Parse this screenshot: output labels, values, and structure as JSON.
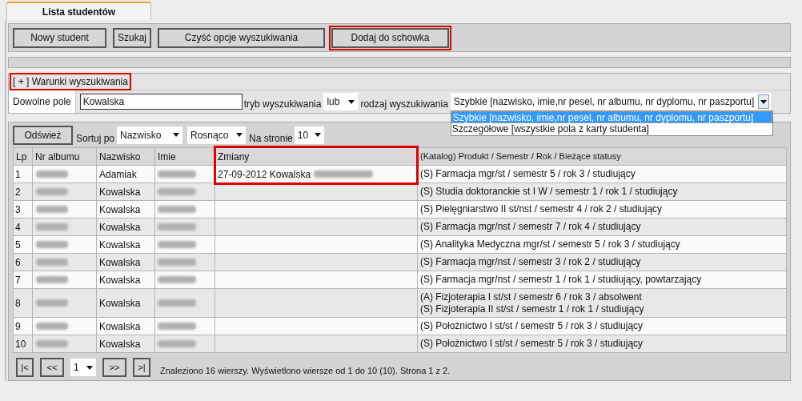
{
  "tabs": [
    {
      "label": "Lista studentów",
      "selected": true
    }
  ],
  "toolbar": {
    "buttons": [
      {
        "label": "Nowy student",
        "highlighted": false
      },
      {
        "label": "Szukaj",
        "highlighted": false
      },
      {
        "label": "Czyść opcje wyszukiwania",
        "highlighted": false
      },
      {
        "label": "Dodaj do schowka",
        "highlighted": true
      }
    ]
  },
  "search": {
    "toggle": {
      "label": "[ + ] Warunki wyszukiwania",
      "highlighted": true
    },
    "field_label": "Dowolne pole",
    "field_value": "Kowalska",
    "mode_label": "tryb wyszukiwania",
    "mode_value": "lub",
    "type_label": "rodzaj wyszukiwania",
    "type_value": "Szybkie [nazwisko, imie,nr pesel, nr albumu, nr dyplomu, nr paszportu]",
    "type_options": [
      {
        "label": "Szybkie [nazwisko, imie,nr pesel, nr albumu, nr dyplomu, nr paszportu]",
        "selected": true
      },
      {
        "label": "Szczegółowe [wszystkie pola z karty studenta]",
        "selected": false
      }
    ]
  },
  "results": {
    "refresh": "Odśwież",
    "sort_label": "Sortuj po",
    "sort_field": "Nazwisko",
    "sort_order": "Rosnąco",
    "per_page_label": "Na stronie",
    "per_page": "10",
    "columns": [
      {
        "label": "Lp",
        "highlighted": false
      },
      {
        "label": "Nr albumu",
        "highlighted": false
      },
      {
        "label": "Nazwisko",
        "highlighted": false
      },
      {
        "label": "Imie",
        "highlighted": false
      },
      {
        "label": "Zmiany",
        "highlighted": true
      },
      {
        "label": "(Katalog) Produkt / Semestr / Rok / Bieżące statusy",
        "highlighted": false
      }
    ],
    "rows": [
      {
        "lp": "1",
        "blurred": true,
        "surname": "Adamiak",
        "changes": "27-09-2012 Kowalska",
        "changes_blurred": true,
        "programs": [
          "(S) Farmacja mgr/st / semestr 5 / rok 3 / studiujący"
        ]
      },
      {
        "lp": "2",
        "blurred": true,
        "surname": "Kowalska",
        "programs": [
          "(S) Studia doktoranckie st I W / semestr 1 / rok 1 / studiujący"
        ]
      },
      {
        "lp": "3",
        "blurred": true,
        "surname": "Kowalska",
        "programs": [
          "(S) Pielęgniarstwo II st/nst / semestr 4 / rok 2 / studiujący"
        ]
      },
      {
        "lp": "4",
        "blurred": true,
        "surname": "Kowalska",
        "programs": [
          "(S) Farmacja mgr/nst / semestr 7 / rok 4 / studiujący"
        ]
      },
      {
        "lp": "5",
        "blurred": true,
        "surname": "Kowalska",
        "programs": [
          "(S) Analityka Medyczna mgr/st / semestr 5 / rok 3 / studiujący"
        ]
      },
      {
        "lp": "6",
        "blurred": true,
        "surname": "Kowalska",
        "programs": [
          "(S) Farmacja mgr/nst / semestr 3 / rok 2 / studiujący"
        ]
      },
      {
        "lp": "7",
        "blurred": true,
        "surname": "Kowalska",
        "programs": [
          "(S) Farmacja mgr/nst / semestr 1 / rok 1 / studiujący, powtarzający"
        ]
      },
      {
        "lp": "8",
        "blurred": true,
        "surname": "Kowalska",
        "programs": [
          "(A) Fizjoterapia I st/st / semestr 6 / rok 3 / absolwent",
          "(S) Fizjoterapia II st/st / semestr 1 / rok 1 / studiujący"
        ]
      },
      {
        "lp": "9",
        "blurred": true,
        "surname": "Kowalska",
        "programs": [
          "(S) Położnictwo I st/st / semestr 5 / rok 3 / studiujący"
        ]
      },
      {
        "lp": "10",
        "blurred": true,
        "surname": "Kowalska",
        "programs": [
          "(S) Położnictwo I st/st / semestr 5 / rok 3 / studiujący"
        ]
      }
    ],
    "pagination": {
      "first": "|<",
      "prev": "<<",
      "page": "1",
      "next": ">>",
      "last": ">|",
      "summary": "Znaleziono 16 wierszy. Wyświetlono wiersze od 1 do 10 (10). Strona 1 z 2."
    }
  }
}
